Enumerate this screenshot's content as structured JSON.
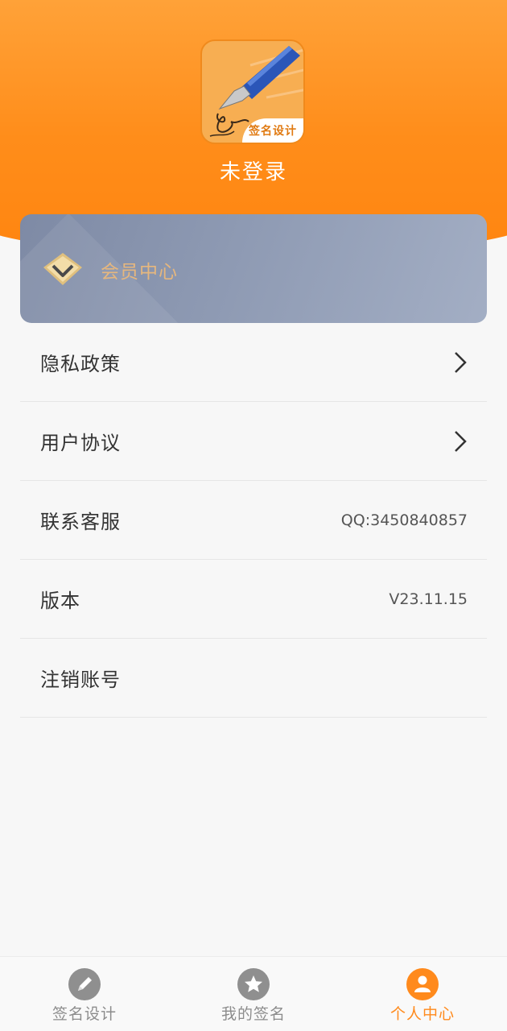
{
  "header": {
    "logo_tag": "签名设计",
    "login_status": "未登录"
  },
  "member": {
    "label": "会员中心"
  },
  "menu": {
    "items": [
      {
        "label": "隐私政策",
        "value": "",
        "arrow": true
      },
      {
        "label": "用户协议",
        "value": "",
        "arrow": true
      },
      {
        "label": "联系客服",
        "value": "QQ:3450840857",
        "arrow": false
      },
      {
        "label": "版本",
        "value": "V23.11.15",
        "arrow": false
      },
      {
        "label": "注销账号",
        "value": "",
        "arrow": false
      }
    ]
  },
  "tabbar": {
    "tabs": [
      {
        "label": "签名设计",
        "icon": "pencil-icon",
        "active": false
      },
      {
        "label": "我的签名",
        "icon": "star-icon",
        "active": false
      },
      {
        "label": "个人中心",
        "icon": "person-icon",
        "active": true
      }
    ]
  },
  "colors": {
    "accent": "#ff8a1c",
    "member_text": "#e6b77e",
    "member_card": "#8e9ab3"
  }
}
